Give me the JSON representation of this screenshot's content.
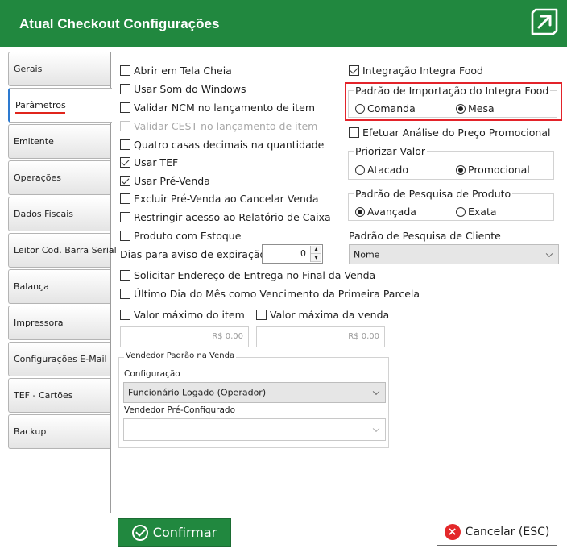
{
  "header": {
    "title": "Atual Checkout Configurações",
    "logo_icon": "arrow-up-right-icon"
  },
  "tabs": [
    {
      "label": "Gerais"
    },
    {
      "label": "Parâmetros"
    },
    {
      "label": "Emitente"
    },
    {
      "label": "Operações"
    },
    {
      "label": "Dados Fiscais"
    },
    {
      "label": "Leitor Cod. Barra Serial"
    },
    {
      "label": "Balança"
    },
    {
      "label": "Impressora"
    },
    {
      "label": "Configurações E-Mail"
    },
    {
      "label": "TEF - Cartões"
    },
    {
      "label": "Backup"
    }
  ],
  "left": {
    "tela_cheia": "Abrir em Tela Cheia",
    "som_windows": "Usar Som do Windows",
    "validar_ncm": "Validar NCM no lançamento de item",
    "validar_cest": "Validar CEST no lançamento de item",
    "quatro_casas": "Quatro casas decimais na quantidade",
    "usar_tef": "Usar TEF",
    "usar_prevenda": "Usar Pré-Venda",
    "excluir_prevenda": "Excluir Pré-Venda ao Cancelar Venda",
    "restringir": "Restringir acesso ao Relatório de Caixa",
    "produto_estoque": "Produto com Estoque",
    "dias_aviso_label": "Dias para aviso de expiração",
    "dias_aviso_value": "0",
    "solicitar_endereco": "Solicitar Endereço de Entrega no Final da Venda",
    "ultimo_dia": "Último Dia do Mês como Vencimento da Primeira Parcela",
    "valor_max_item": "Valor máximo do item",
    "valor_max_venda": "Valor máxima da venda",
    "valor_item_value": "R$ 0,00",
    "valor_venda_value": "R$ 0,00",
    "vendedor_group": "Vendedor Padrão na Venda",
    "configuracao_label": "Configuração",
    "configuracao_value": "Funcionário Logado (Operador)",
    "vendedor_pre_label": "Vendedor Pré-Configurado",
    "vendedor_pre_value": ""
  },
  "right": {
    "integra_food": "Integração Integra Food",
    "importacao_group": "Padrão de Importação do Integra Food",
    "comanda": "Comanda",
    "mesa": "Mesa",
    "analise_preco": "Efetuar Análise do Preço Promocional",
    "priorizar_group": "Priorizar Valor",
    "atacado": "Atacado",
    "promocional": "Promocional",
    "pesquisa_produto_group": "Padrão de Pesquisa de Produto",
    "avancada": "Avançada",
    "exata": "Exata",
    "pesquisa_cliente_label": "Padrão de Pesquisa de Cliente",
    "pesquisa_cliente_value": "Nome"
  },
  "footer": {
    "confirm": "Confirmar",
    "cancel": "Cancelar (ESC)"
  },
  "colors": {
    "brand_green": "#21883f",
    "highlight_red": "#e3232a",
    "active_tab_blue": "#2d7ad0"
  }
}
